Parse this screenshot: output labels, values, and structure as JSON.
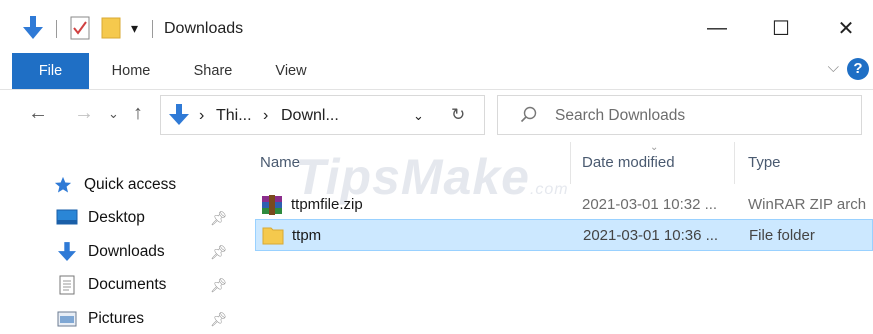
{
  "window": {
    "title": "Downloads",
    "minimize_glyph": "—",
    "maximize_glyph": "☐",
    "close_glyph": "✕"
  },
  "ribbon": {
    "tabs": [
      {
        "label": "File"
      },
      {
        "label": "Home"
      },
      {
        "label": "Share"
      },
      {
        "label": "View"
      }
    ],
    "help_glyph": "?",
    "expand_glyph": "⌵"
  },
  "address_bar": {
    "crumbs": [
      "Thi...",
      "Downl..."
    ],
    "separator": "›"
  },
  "search": {
    "placeholder": "Search Downloads"
  },
  "nav_pane": {
    "items": [
      {
        "label": "Quick access",
        "icon": "star-icon",
        "pinned": false
      },
      {
        "label": "Desktop",
        "icon": "desktop-icon",
        "pinned": true
      },
      {
        "label": "Downloads",
        "icon": "download-arrow-icon",
        "pinned": true
      },
      {
        "label": "Documents",
        "icon": "document-icon",
        "pinned": true
      },
      {
        "label": "Pictures",
        "icon": "pictures-icon",
        "pinned": true
      }
    ]
  },
  "file_list": {
    "columns": [
      "Name",
      "Date modified",
      "Type"
    ],
    "rows": [
      {
        "name": "ttpmfile.zip",
        "date": "2021-03-01 10:32 ...",
        "type": "WinRAR ZIP arch",
        "icon": "winrar-archive-icon",
        "selected": false
      },
      {
        "name": "ttpm",
        "date": "2021-03-01 10:36 ...",
        "type": "File folder",
        "icon": "folder-icon",
        "selected": true
      }
    ]
  },
  "watermark": {
    "text": "TipsMake",
    "suffix": ".com"
  },
  "colors": {
    "accent": "#1f6fc5",
    "selection_bg": "#cce8ff",
    "selection_border": "#99d1ff",
    "folder_yellow": "#f5c94d"
  }
}
